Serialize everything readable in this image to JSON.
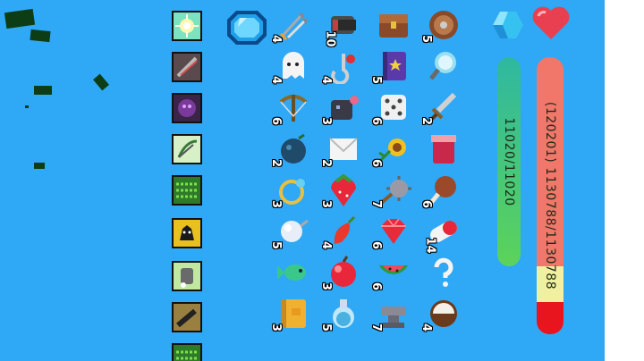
{
  "colors": {
    "background": "#2fa8f5",
    "mana_bar_top": "#2fb8a0",
    "mana_bar_bottom": "#5cd35a",
    "health_bar": "#f0776a",
    "health_bar_highlight": "#f0f0a0",
    "health_bar_red": "#e8141e"
  },
  "skills": [
    "light-burst-skill",
    "gatling-skill",
    "shadow-skill",
    "bow-skill",
    "green-slime-skill",
    "black-beast-skill",
    "stone-golem-skill",
    "iron-cannon-skill",
    "green-slime-skill-2"
  ],
  "items": [
    {
      "icon": "arrows-icon",
      "count": "4"
    },
    {
      "icon": "cannon-icon",
      "count": "10"
    },
    {
      "icon": "treasure-chest-icon",
      "count": ""
    },
    {
      "icon": "round-shield-icon",
      "count": "5"
    },
    {
      "icon": "ghost-icon",
      "count": "4"
    },
    {
      "icon": "hook-icon",
      "count": "4"
    },
    {
      "icon": "spellbook-icon",
      "count": "5"
    },
    {
      "icon": "magnifier-icon",
      "count": ""
    },
    {
      "icon": "crossbow-icon",
      "count": "6"
    },
    {
      "icon": "bomb-robot-icon",
      "count": "3"
    },
    {
      "icon": "dice-icon",
      "count": "6"
    },
    {
      "icon": "sword-icon",
      "count": "2"
    },
    {
      "icon": "blue-berry-icon",
      "count": "2"
    },
    {
      "icon": "envelope-icon",
      "count": "2"
    },
    {
      "icon": "sunflower-icon",
      "count": "6"
    },
    {
      "icon": "jam-jar-icon",
      "count": ""
    },
    {
      "icon": "ring-icon",
      "count": "3"
    },
    {
      "icon": "strawberry-icon",
      "count": "3"
    },
    {
      "icon": "spiked-mace-icon",
      "count": "7"
    },
    {
      "icon": "meat-leg-icon",
      "count": "6"
    },
    {
      "icon": "glass-orb-icon",
      "count": "5"
    },
    {
      "icon": "red-chili-icon",
      "count": "4"
    },
    {
      "icon": "ruby-icon",
      "count": "6"
    },
    {
      "icon": "pill-capsule-icon",
      "count": "14"
    },
    {
      "icon": "green-fish-icon",
      "count": ""
    },
    {
      "icon": "red-apple-icon",
      "count": "3"
    },
    {
      "icon": "watermelon-icon",
      "count": "6"
    },
    {
      "icon": "question-mark-icon",
      "count": ""
    },
    {
      "icon": "golden-book-icon",
      "count": "3"
    },
    {
      "icon": "potion-icon",
      "count": "5"
    },
    {
      "icon": "anvil-icon",
      "count": "7"
    },
    {
      "icon": "coconut-icon",
      "count": "4"
    }
  ],
  "mana": {
    "icon": "blue-crystal-icon",
    "label": "11020/11020",
    "fill": 1.0
  },
  "health": {
    "icon": "heart-icon",
    "label": "(120201) 1130788/1130788"
  }
}
